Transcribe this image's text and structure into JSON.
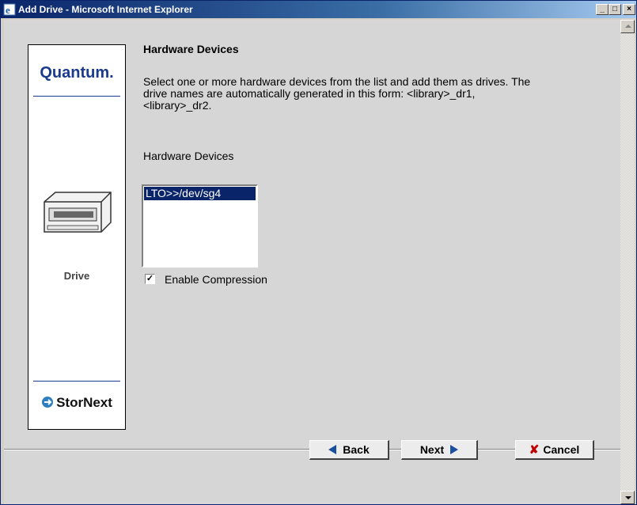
{
  "window": {
    "title": "Add Drive - Microsoft Internet Explorer",
    "controls": {
      "minimize": "_",
      "maximize": "□",
      "close": "×"
    }
  },
  "sidebar": {
    "brand": "Quantum.",
    "device_label": "Drive",
    "product": "StorNext",
    "accent_color": "#1a3b8c"
  },
  "main": {
    "heading": "Hardware Devices",
    "description": "Select one or more hardware devices from the list and add them as drives. The drive names are automatically generated in this form: <library>_dr1, <library>_dr2.",
    "list_label": "Hardware Devices",
    "devices": [
      "LTO>>/dev/sg4"
    ],
    "selected_device": "LTO>>/dev/sg4",
    "compression": {
      "label": "Enable Compression",
      "checked": true
    }
  },
  "buttons": {
    "back": "Back",
    "next": "Next",
    "cancel": "Cancel"
  }
}
